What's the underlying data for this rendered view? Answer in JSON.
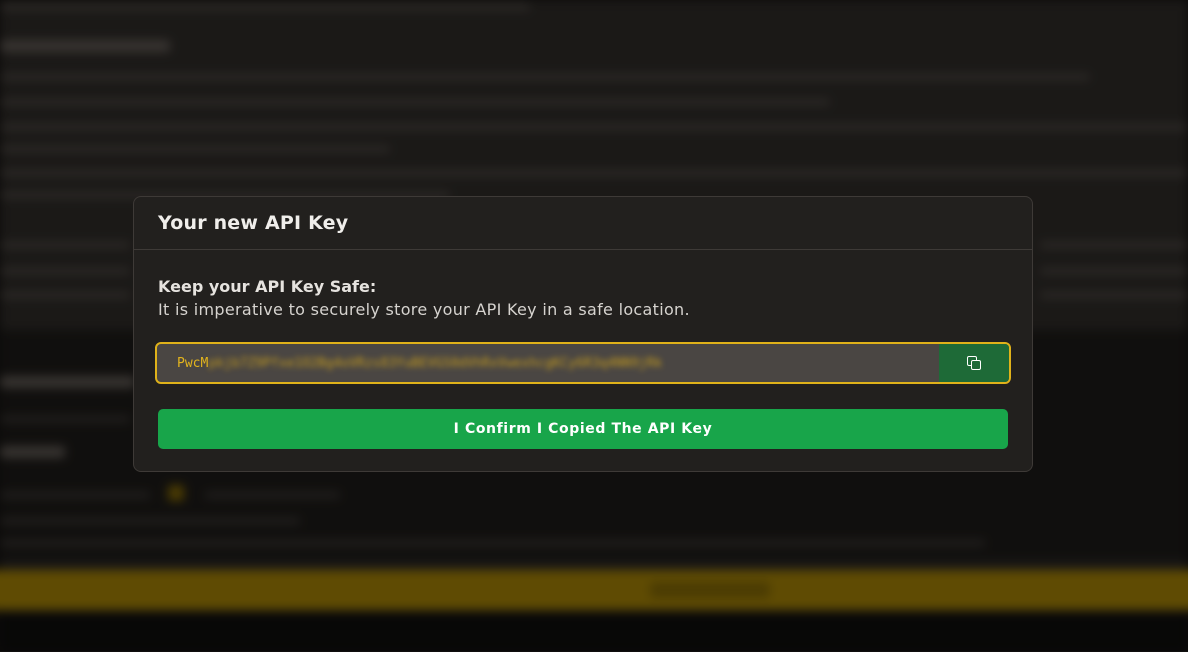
{
  "modal": {
    "title": "Your new API Key",
    "warning_title": "Keep your API Key Safe:",
    "warning_text": "It is imperative to securely store your API Key in a safe location.",
    "api_key_visible": "PwcM",
    "api_key_hidden": "pkjb7Z9Pfxe1O2Bg4oVRzs83YuBEVGS0dVhRxVwexhcgKCy6R3q4NN9jRk",
    "copy_icon": "copy-icon",
    "confirm_label": "I Confirm I Copied The API Key"
  },
  "colors": {
    "modal_bg": "#22201e",
    "key_border": "#e0b21a",
    "key_text": "#e3b41d",
    "copy_button_bg": "#1e6a37",
    "confirm_bg": "#18a54a",
    "background_accent": "#9a7a06"
  }
}
